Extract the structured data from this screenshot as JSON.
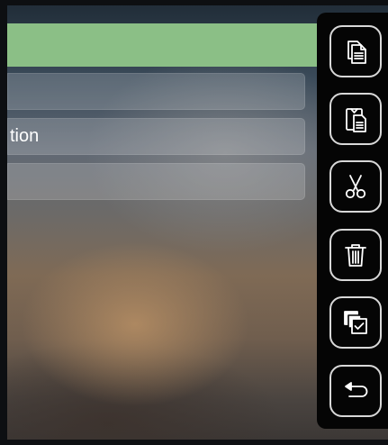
{
  "list": {
    "rows": [
      {
        "label": "",
        "selected": true
      },
      {
        "label": "",
        "selected": false
      },
      {
        "label": "tion",
        "selected": false
      },
      {
        "label": "",
        "selected": false
      }
    ]
  },
  "toolbar": {
    "buttons": [
      {
        "icon": "copy-icon"
      },
      {
        "icon": "paste-icon"
      },
      {
        "icon": "scissors-icon"
      },
      {
        "icon": "trash-icon"
      },
      {
        "icon": "select-all-icon"
      },
      {
        "icon": "back-icon"
      }
    ]
  },
  "colors": {
    "selected_row": "#8bbf86",
    "toolbar_bg": "#050505",
    "icon_stroke": "#ffffff"
  }
}
